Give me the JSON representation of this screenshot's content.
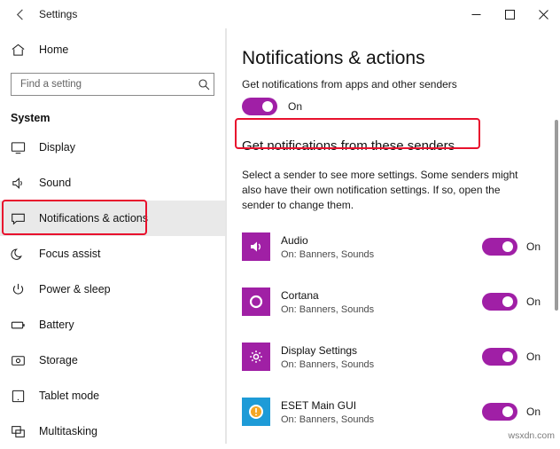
{
  "titlebar": {
    "back_label": "back-arrow",
    "title": "Settings",
    "minimize": "minimize",
    "maximize": "maximize",
    "close": "close"
  },
  "sidebar": {
    "home": {
      "label": "Home",
      "icon": "home-icon"
    },
    "search": {
      "placeholder": "Find a setting",
      "value": "",
      "icon": "search-icon"
    },
    "section": "System",
    "items": [
      {
        "label": "Display",
        "icon": "monitor-icon",
        "selected": false
      },
      {
        "label": "Sound",
        "icon": "speaker-icon",
        "selected": false
      },
      {
        "label": "Notifications & actions",
        "icon": "chat-icon",
        "selected": true
      },
      {
        "label": "Focus assist",
        "icon": "moon-icon",
        "selected": false
      },
      {
        "label": "Power & sleep",
        "icon": "power-icon",
        "selected": false
      },
      {
        "label": "Battery",
        "icon": "battery-icon",
        "selected": false
      },
      {
        "label": "Storage",
        "icon": "disk-icon",
        "selected": false
      },
      {
        "label": "Tablet mode",
        "icon": "tablet-icon",
        "selected": false
      },
      {
        "label": "Multitasking",
        "icon": "windows-icon",
        "selected": false
      }
    ]
  },
  "main": {
    "page_title": "Notifications & actions",
    "clipped_setting_label": "Get notifications from apps and other senders",
    "master_toggle": {
      "state": "On",
      "on": true
    },
    "section_title": "Get notifications from these senders",
    "description": "Select a sender to see more settings. Some senders might also have their own notification settings. If so, open the sender to change them.",
    "senders": [
      {
        "name": "Audio",
        "sub": "On: Banners, Sounds",
        "icon": "audio-icon",
        "icon_color": "#a020a5",
        "toggle": "On",
        "on": true
      },
      {
        "name": "Cortana",
        "sub": "On: Banners, Sounds",
        "icon": "cortana-icon",
        "icon_color": "#a020a5",
        "toggle": "On",
        "on": true
      },
      {
        "name": "Display Settings",
        "sub": "On: Banners, Sounds",
        "icon": "gear-icon",
        "icon_color": "#a020a5",
        "toggle": "On",
        "on": true
      },
      {
        "name": "ESET Main GUI",
        "sub": "On: Banners, Sounds",
        "icon": "eset-icon",
        "icon_color": "#1e9bd7",
        "toggle": "On",
        "on": true
      }
    ]
  },
  "annotations": {
    "nav_highlight": "Notifications & actions",
    "heading_highlight": "Get notifications from these senders",
    "accent_color": "#a01fa6",
    "annotation_color": "#e8112d"
  },
  "watermark": "wsxdn.com"
}
